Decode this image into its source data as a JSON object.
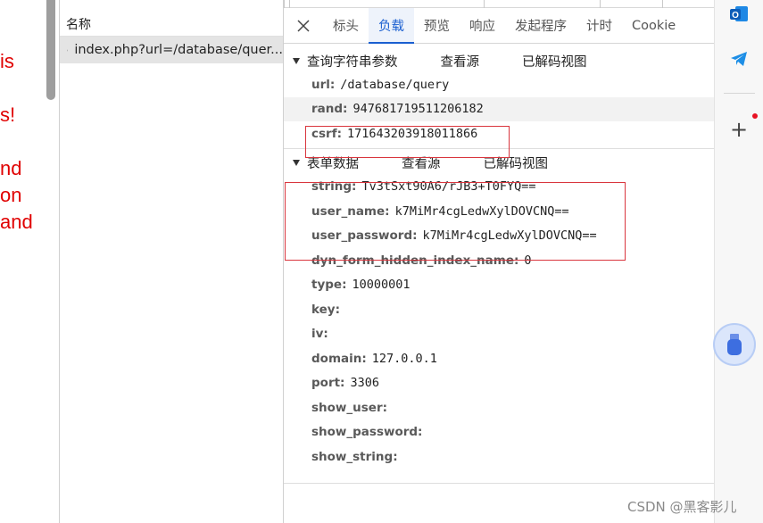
{
  "page_fragments": [
    "is",
    "s!",
    "nd",
    "on",
    "and"
  ],
  "request_list": {
    "column_header": "名称",
    "rows": [
      {
        "name": "index.php?url=/database/quer..."
      }
    ]
  },
  "tabs": [
    {
      "label": "标头",
      "active": false
    },
    {
      "label": "负载",
      "active": true
    },
    {
      "label": "预览",
      "active": false
    },
    {
      "label": "响应",
      "active": false
    },
    {
      "label": "发起程序",
      "active": false
    },
    {
      "label": "计时",
      "active": false
    },
    {
      "label": "Cookie",
      "active": false
    }
  ],
  "query_section": {
    "title": "查询字符串参数",
    "view_source": "查看源",
    "view_decoded": "已解码视图",
    "params": [
      {
        "key": "url:",
        "value": "/database/query"
      },
      {
        "key": "rand:",
        "value": "947681719511206182"
      },
      {
        "key": "csrf:",
        "value": "171643203918011866"
      }
    ]
  },
  "form_section": {
    "title": "表单数据",
    "view_source": "查看源",
    "view_decoded": "已解码视图",
    "params": [
      {
        "key": "string:",
        "value": "Tv3tSxt90A6/rJB3+T0FYQ=="
      },
      {
        "key": "user_name:",
        "value": "k7MiMr4cgLedwXylDOVCNQ=="
      },
      {
        "key": "user_password:",
        "value": "k7MiMr4cgLedwXylDOVCNQ=="
      },
      {
        "key": "dyn_form_hidden_index_name:",
        "value": "0"
      },
      {
        "key": "type:",
        "value": "10000001"
      },
      {
        "key": "key:",
        "value": ""
      },
      {
        "key": "iv:",
        "value": ""
      },
      {
        "key": "domain:",
        "value": "127.0.0.1"
      },
      {
        "key": "port:",
        "value": "3306"
      },
      {
        "key": "show_user:",
        "value": ""
      },
      {
        "key": "show_password:",
        "value": ""
      },
      {
        "key": "show_string:",
        "value": ""
      }
    ]
  },
  "sidebar": {
    "items": [
      "outlook-icon",
      "telegram-icon",
      "add-icon"
    ]
  },
  "watermark": "CSDN @黑客影儿",
  "colors": {
    "accent": "#1a5fd0",
    "highlight_box": "#d9363e",
    "page_text": "#e00000"
  }
}
